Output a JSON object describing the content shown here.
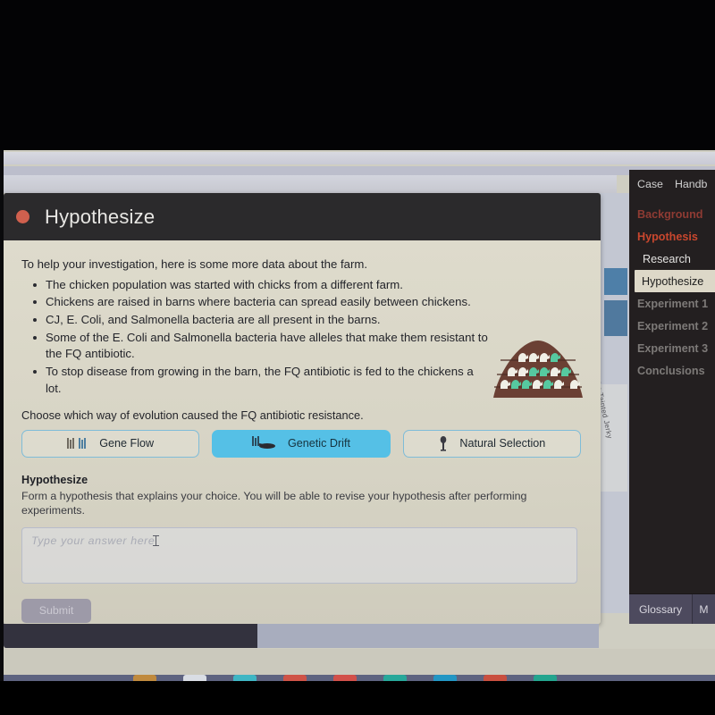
{
  "card": {
    "header": {
      "title": "Hypothesize",
      "dot_color": "#d0604e"
    },
    "intro": "To help your investigation, here is some more data about the farm.",
    "facts": [
      "The chicken population was started with chicks from a different farm.",
      "Chickens are raised in barns where bacteria can spread easily between chickens.",
      "CJ, E. Coli, and Salmonella bacteria are all present in the barns.",
      "Some of the E. Coli and Salmonella bacteria have alleles that make them resistant to the FQ antibiotic.",
      "To stop disease from growing in the barn, the FQ antibiotic is fed to the chickens a lot."
    ],
    "choose_prompt": "Choose which way of evolution caused the FQ antibiotic resistance.",
    "choices": [
      {
        "label": "Gene Flow",
        "icon": "chromosomes-icon",
        "selected": false
      },
      {
        "label": "Genetic Drift",
        "icon": "drift-icon",
        "selected": true
      },
      {
        "label": "Natural Selection",
        "icon": "selection-pin-icon",
        "selected": false
      }
    ],
    "section_title": "Hypothesize",
    "section_desc": "Form a hypothesis that explains your choice. You will be able to revise your hypothesis after performing experiments.",
    "answer_placeholder": "Type your answer here",
    "answer_value": "",
    "submit_label": "Submit",
    "accent_selected": "#55c0e6",
    "accent_border": "#7fbcd8"
  },
  "illustration": {
    "name": "barn-with-chickens",
    "barn_color": "#6b4034",
    "chicken_white": "#f0efe6",
    "chicken_green": "#56c9a0",
    "rows": [
      4,
      5,
      6
    ]
  },
  "sidebar": {
    "tabs": [
      {
        "label": "Case"
      },
      {
        "label": "Handb"
      }
    ],
    "items": [
      {
        "label": "Background",
        "type": "cat",
        "active": false
      },
      {
        "label": "Hypothesis",
        "type": "cat",
        "active": true
      },
      {
        "label": "Research",
        "type": "sub",
        "current": false
      },
      {
        "label": "Hypothesize",
        "type": "sub",
        "current": true
      },
      {
        "label": "Experiment 1",
        "type": "dim",
        "active": false
      },
      {
        "label": "Experiment 2",
        "type": "dim",
        "active": false
      },
      {
        "label": "Experiment 3",
        "type": "dim",
        "active": false
      },
      {
        "label": "Conclusions",
        "type": "dim",
        "active": false
      }
    ],
    "bottom": {
      "glossary_label": "Glossary",
      "more_label": "M"
    },
    "colors": {
      "background": "#231f20",
      "category": "#8f3b33",
      "category_active": "#c9472e",
      "highlight_bg": "#ddd8c8"
    }
  },
  "background_page": {
    "rotated_text": "Case of the Tainted Jerky"
  },
  "taskbar": {
    "icons": [
      {
        "name": "app-icon-1",
        "color": "#c08a3e"
      },
      {
        "name": "app-icon-2",
        "color": "#d9dde4"
      },
      {
        "name": "app-icon-3",
        "color": "#3fb6c4"
      },
      {
        "name": "app-icon-4",
        "color": "#cf5347"
      },
      {
        "name": "app-icon-5",
        "color": "#d2504a"
      },
      {
        "name": "app-icon-6",
        "color": "#27a89a"
      },
      {
        "name": "app-icon-7",
        "color": "#2296c4"
      },
      {
        "name": "app-icon-8",
        "color": "#c94f3f"
      },
      {
        "name": "app-icon-9",
        "color": "#23a58e"
      }
    ]
  }
}
